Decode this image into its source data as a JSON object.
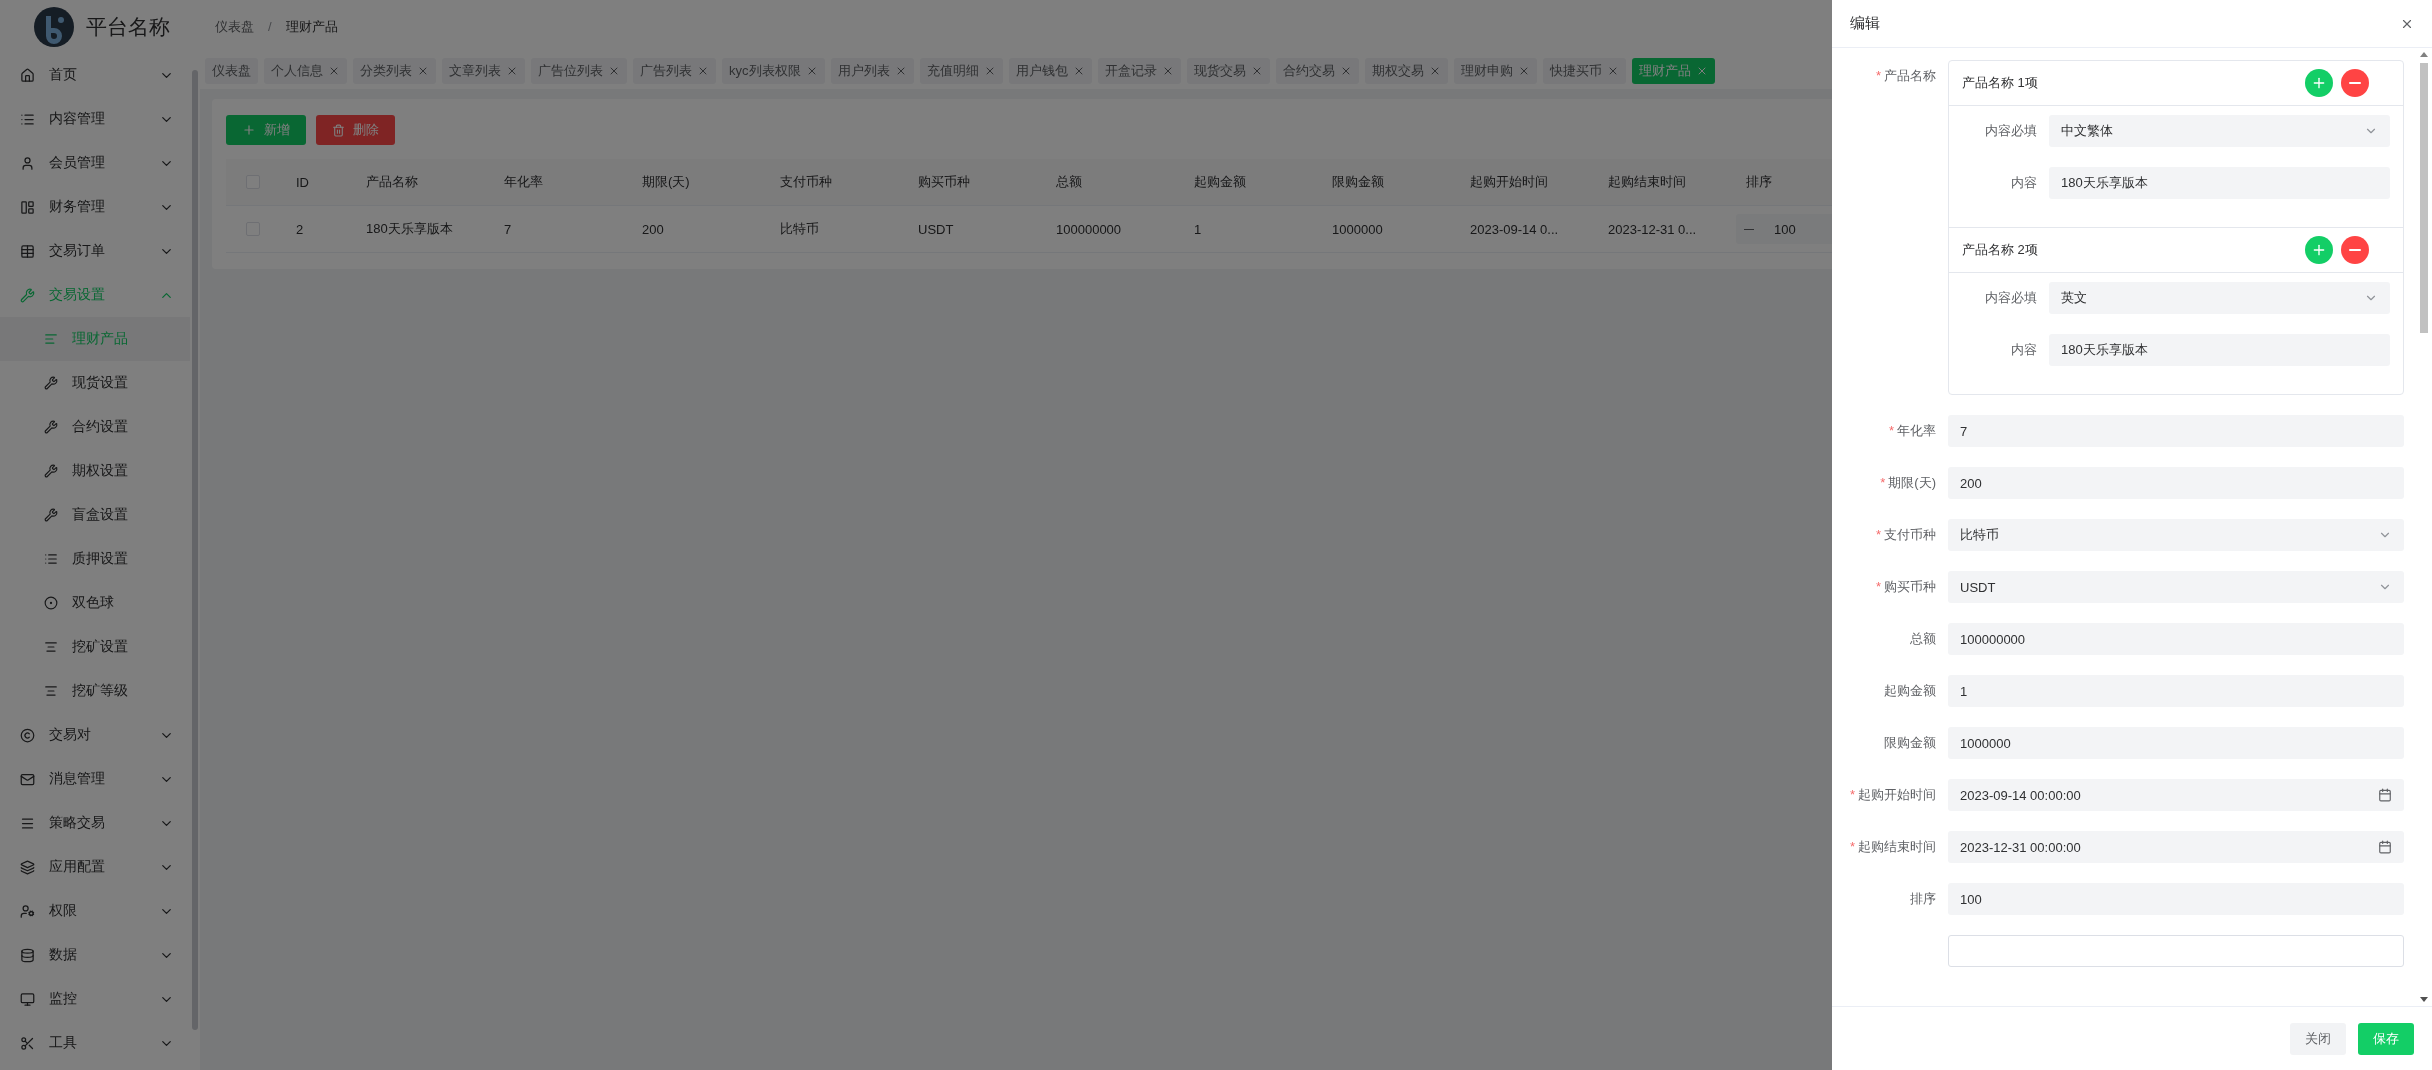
{
  "brand": {
    "name": "平台名称"
  },
  "breadcrumb": {
    "separator": "/",
    "items": [
      "仪表盘",
      "理财产品"
    ]
  },
  "sidebar": {
    "items": [
      {
        "label": "首页",
        "expanded": false
      },
      {
        "label": "内容管理",
        "expanded": false
      },
      {
        "label": "会员管理",
        "expanded": false
      },
      {
        "label": "财务管理",
        "expanded": false
      },
      {
        "label": "交易订单",
        "expanded": false
      },
      {
        "label": "交易设置",
        "expanded": true,
        "children": [
          {
            "label": "理财产品",
            "selected": true
          },
          {
            "label": "现货设置",
            "selected": false
          },
          {
            "label": "合约设置",
            "selected": false
          },
          {
            "label": "期权设置",
            "selected": false
          },
          {
            "label": "盲盒设置",
            "selected": false
          },
          {
            "label": "质押设置",
            "selected": false
          },
          {
            "label": "双色球",
            "selected": false
          },
          {
            "label": "挖矿设置",
            "selected": false
          },
          {
            "label": "挖矿等级",
            "selected": false
          }
        ]
      },
      {
        "label": "交易对",
        "expanded": false
      },
      {
        "label": "消息管理",
        "expanded": false
      },
      {
        "label": "策略交易",
        "expanded": false
      },
      {
        "label": "应用配置",
        "expanded": false
      },
      {
        "label": "权限",
        "expanded": false
      },
      {
        "label": "数据",
        "expanded": false
      },
      {
        "label": "监控",
        "expanded": false
      },
      {
        "label": "工具",
        "expanded": false
      }
    ]
  },
  "tabs": [
    {
      "label": "仪表盘",
      "selected": false,
      "closable": false
    },
    {
      "label": "个人信息",
      "selected": false,
      "closable": true
    },
    {
      "label": "分类列表",
      "selected": false,
      "closable": true
    },
    {
      "label": "文章列表",
      "selected": false,
      "closable": true
    },
    {
      "label": "广告位列表",
      "selected": false,
      "closable": true
    },
    {
      "label": "广告列表",
      "selected": false,
      "closable": true
    },
    {
      "label": "kyc列表权限",
      "selected": false,
      "closable": true
    },
    {
      "label": "用户列表",
      "selected": false,
      "closable": true
    },
    {
      "label": "充值明细",
      "selected": false,
      "closable": true
    },
    {
      "label": "用户钱包",
      "selected": false,
      "closable": true
    },
    {
      "label": "开盒记录",
      "selected": false,
      "closable": true
    },
    {
      "label": "现货交易",
      "selected": false,
      "closable": true
    },
    {
      "label": "合约交易",
      "selected": false,
      "closable": true
    },
    {
      "label": "期权交易",
      "selected": false,
      "closable": true
    },
    {
      "label": "理财申购",
      "selected": false,
      "closable": true
    },
    {
      "label": "快捷买币",
      "selected": false,
      "closable": true
    },
    {
      "label": "理财产品",
      "selected": true,
      "closable": true
    }
  ],
  "toolbar": {
    "buttons": [
      {
        "label": "新增",
        "kind": "add"
      },
      {
        "label": "删除",
        "kind": "delete"
      }
    ]
  },
  "table": {
    "all_checked": false,
    "columns": [
      "ID",
      "产品名称",
      "年化率",
      "期限(天)",
      "支付币种",
      "购买币种",
      "总额",
      "起购金额",
      "限购金额",
      "起购开始时间",
      "起购结束时间",
      "排序"
    ],
    "rows": [
      {
        "checked": false,
        "cells": [
          {
            "kind": "text",
            "value": "2"
          },
          {
            "kind": "text",
            "value": "180天乐享版本"
          },
          {
            "kind": "text",
            "value": "7"
          },
          {
            "kind": "text",
            "value": "200"
          },
          {
            "kind": "text",
            "value": "比特币"
          },
          {
            "kind": "text",
            "value": "USDT"
          },
          {
            "kind": "text",
            "value": "100000000"
          },
          {
            "kind": "text",
            "value": "1"
          },
          {
            "kind": "text",
            "value": "1000000"
          },
          {
            "kind": "text",
            "value": "2023-09-14 0..."
          },
          {
            "kind": "text",
            "value": "2023-12-31 0..."
          },
          {
            "kind": "number",
            "value": "100"
          }
        ]
      }
    ]
  },
  "drawer": {
    "title": "编辑",
    "required_mark": "*",
    "fields": [
      {
        "kind": "group",
        "label": "产品名称",
        "required": true,
        "items": [
          {
            "title": "产品名称 1项",
            "fields": [
              {
                "kind": "select",
                "label": "内容必填",
                "value": "中文繁体"
              },
              {
                "kind": "text",
                "label": "内容",
                "value": "180天乐享版本"
              }
            ]
          },
          {
            "title": "产品名称 2项",
            "fields": [
              {
                "kind": "select",
                "label": "内容必填",
                "value": "英文"
              },
              {
                "kind": "text",
                "label": "内容",
                "value": "180天乐享版本"
              }
            ]
          }
        ]
      },
      {
        "kind": "text",
        "label": "年化率",
        "required": true,
        "value": "7"
      },
      {
        "kind": "text",
        "label": "期限(天)",
        "required": true,
        "value": "200"
      },
      {
        "kind": "select",
        "label": "支付币种",
        "required": true,
        "value": "比特币"
      },
      {
        "kind": "select",
        "label": "购买币种",
        "required": true,
        "value": "USDT"
      },
      {
        "kind": "text",
        "label": "总额",
        "required": false,
        "value": "100000000"
      },
      {
        "kind": "text",
        "label": "起购金额",
        "required": false,
        "value": "1"
      },
      {
        "kind": "text",
        "label": "限购金额",
        "required": false,
        "value": "1000000"
      },
      {
        "kind": "date",
        "label": "起购开始时间",
        "required": true,
        "value": "2023-09-14 00:00:00"
      },
      {
        "kind": "date",
        "label": "起购结束时间",
        "required": true,
        "value": "2023-12-31 00:00:00"
      },
      {
        "kind": "text",
        "label": "排序",
        "required": false,
        "value": "100"
      },
      {
        "kind": "blank"
      }
    ],
    "footer": [
      {
        "label": "关闭",
        "kind": "secondary"
      },
      {
        "label": "保存",
        "kind": "primary"
      }
    ]
  }
}
